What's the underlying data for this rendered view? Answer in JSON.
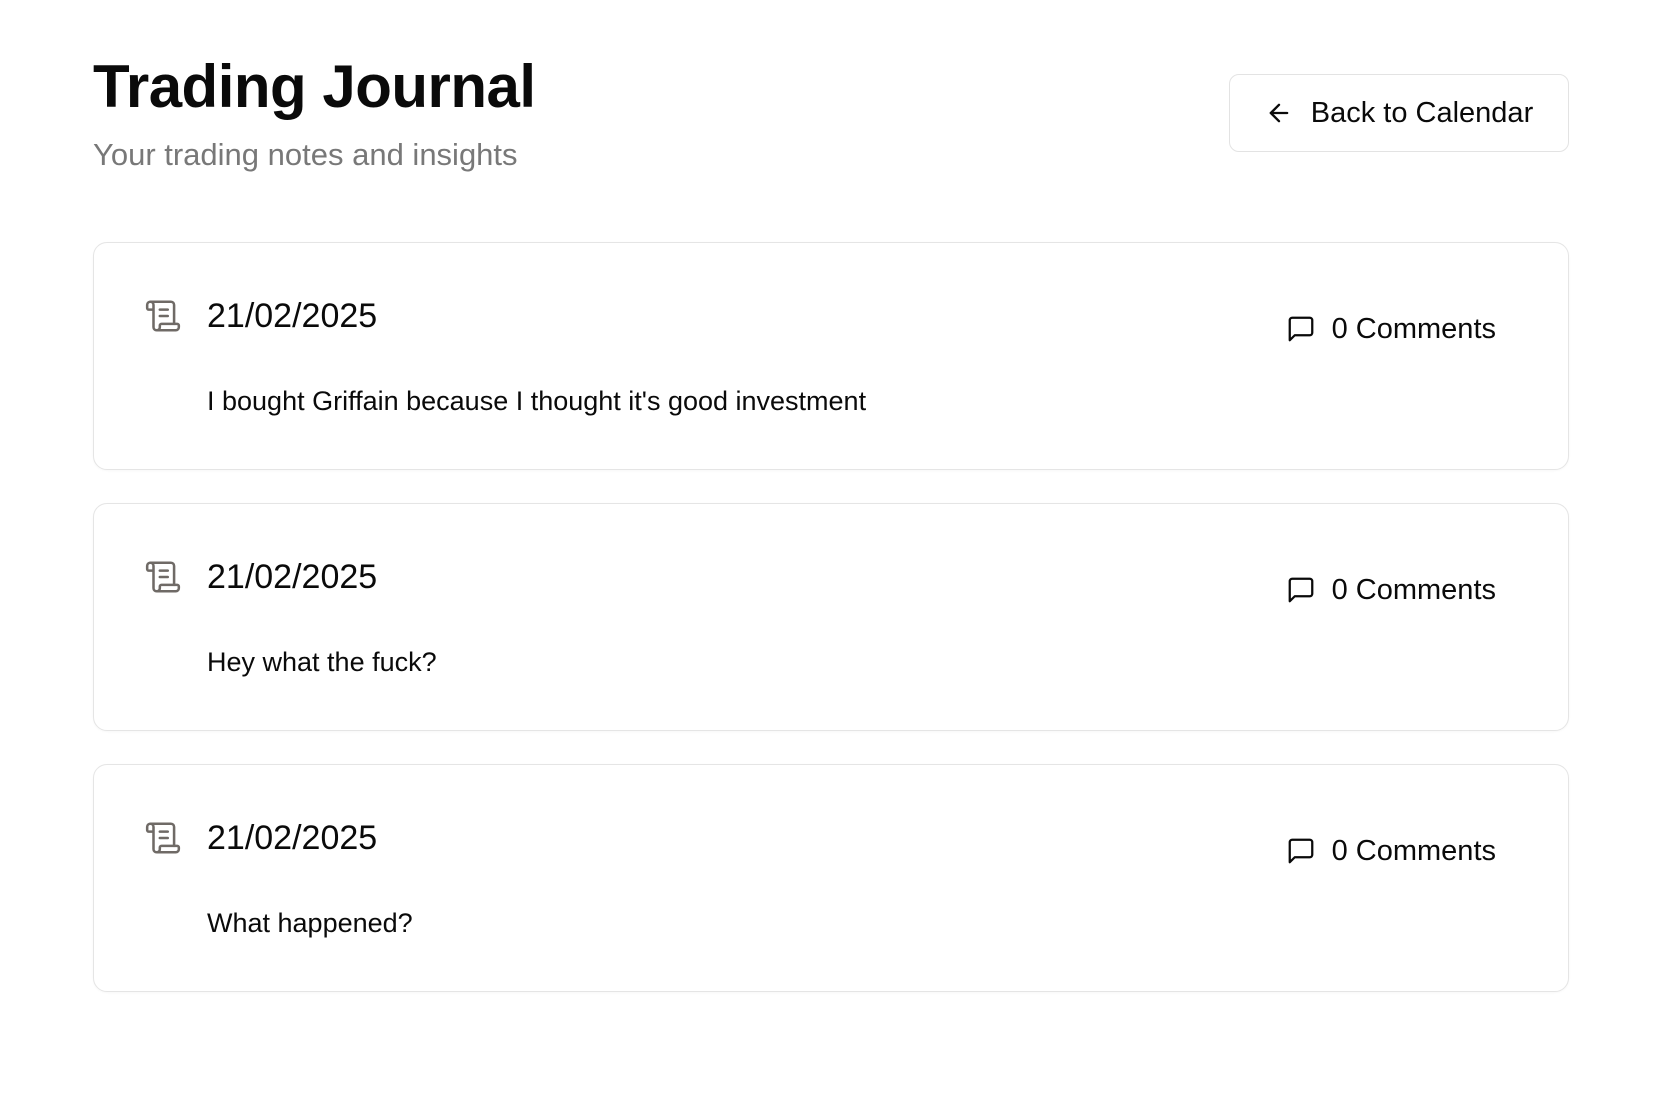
{
  "header": {
    "title": "Trading Journal",
    "subtitle": "Your trading notes and insights",
    "back_button_label": "Back to Calendar"
  },
  "entries": [
    {
      "date": "21/02/2025",
      "comments_label": "0 Comments",
      "text": "I bought Griffain because I thought it's good investment"
    },
    {
      "date": "21/02/2025",
      "comments_label": "0 Comments",
      "text": "Hey what the fuck?"
    },
    {
      "date": "21/02/2025",
      "comments_label": "0 Comments",
      "text": "What happened?"
    }
  ],
  "icons": {
    "back": "arrow-left-icon",
    "entry": "scroll-icon",
    "comments": "message-square-icon"
  },
  "colors": {
    "text": "#0a0a0a",
    "muted": "#787878",
    "icon_muted": "#6f6a66",
    "border": "#e5e5e5"
  }
}
